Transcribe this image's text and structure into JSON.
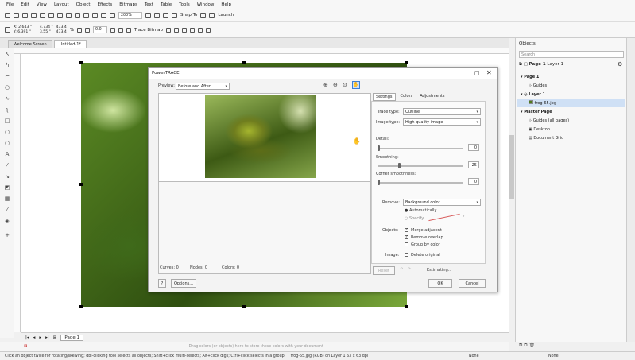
{
  "menu": [
    "File",
    "Edit",
    "View",
    "Layout",
    "Object",
    "Effects",
    "Bitmaps",
    "Text",
    "Table",
    "Tools",
    "Window",
    "Help"
  ],
  "toolbar": {
    "zoom": "200%",
    "snap_to": "Snap To",
    "launch": "Launch"
  },
  "propbar": {
    "x": "X: 2.643 \"",
    "y": "Y: 6.391 \"",
    "w": "4.734 \"",
    "h": "3.55 \"",
    "sw": "473.4",
    "sh": "473.4",
    "pct": "%",
    "angle": "0.0",
    "trace": "Trace Bitmap"
  },
  "doc_tabs": {
    "welcome": "Welcome Screen",
    "doc": "Untitled-1*"
  },
  "dialog": {
    "title": "PowerTRACE",
    "preview_label": "Preview:",
    "preview_value": "Before and After",
    "tabs": [
      "Settings",
      "Colors",
      "Adjustments"
    ],
    "trace_type_label": "Trace type:",
    "trace_type_value": "Outline",
    "image_type_label": "Image type:",
    "image_type_value": "High quality image",
    "detail_label": "Detail:",
    "detail_value": "0",
    "smoothing_label": "Smoothing:",
    "smoothing_value": "25",
    "corner_label": "Corner smoothness:",
    "corner_value": "0",
    "remove_label": "Remove:",
    "remove_value": "Background color",
    "auto_label": "Automatically",
    "specify_label": "Specify",
    "objects_label": "Objects:",
    "merge_label": "Merge adjacent",
    "overlap_label": "Remove overlap",
    "group_label": "Group by color",
    "image_label": "Image:",
    "delete_label": "Delete original",
    "curves": "Curves:  0",
    "nodes": "Nodes:  0",
    "colors": "Colors:  0",
    "reset": "Reset",
    "estimating": "Estimating...",
    "ok": "OK",
    "cancel": "Cancel",
    "help": "?",
    "options": "Options..."
  },
  "objects_panel": {
    "title": "Objects",
    "search": "Search",
    "header_page": "Page 1",
    "header_layer": "Layer 1",
    "rows": [
      {
        "label": "Page 1",
        "level": 0
      },
      {
        "label": "Guides",
        "level": 1
      },
      {
        "label": "Layer 1",
        "level": 1
      },
      {
        "label": "frog-65.jpg",
        "level": 2
      },
      {
        "label": "Master Page",
        "level": 0
      },
      {
        "label": "Guides (all pages)",
        "level": 1
      },
      {
        "label": "Desktop",
        "level": 1
      },
      {
        "label": "Document Grid",
        "level": 1
      }
    ]
  },
  "page_nav": {
    "page": "Page 1"
  },
  "status": {
    "hint": "Click an object twice for rotating/skewing; dbl-clicking tool selects all objects; Shift+click multi-selects; Alt+click digs; Ctrl+click selects in a group",
    "info": "frog-65.jpg (RGB) on Layer 1 63 x 63 dpi",
    "fill": "None",
    "outline": "None"
  },
  "canvas_hint": "Drag colors (or objects) here to store these colors with your document",
  "colors": {
    "accent": "#3c7fd3",
    "photo_green": "#4f7c1e"
  }
}
